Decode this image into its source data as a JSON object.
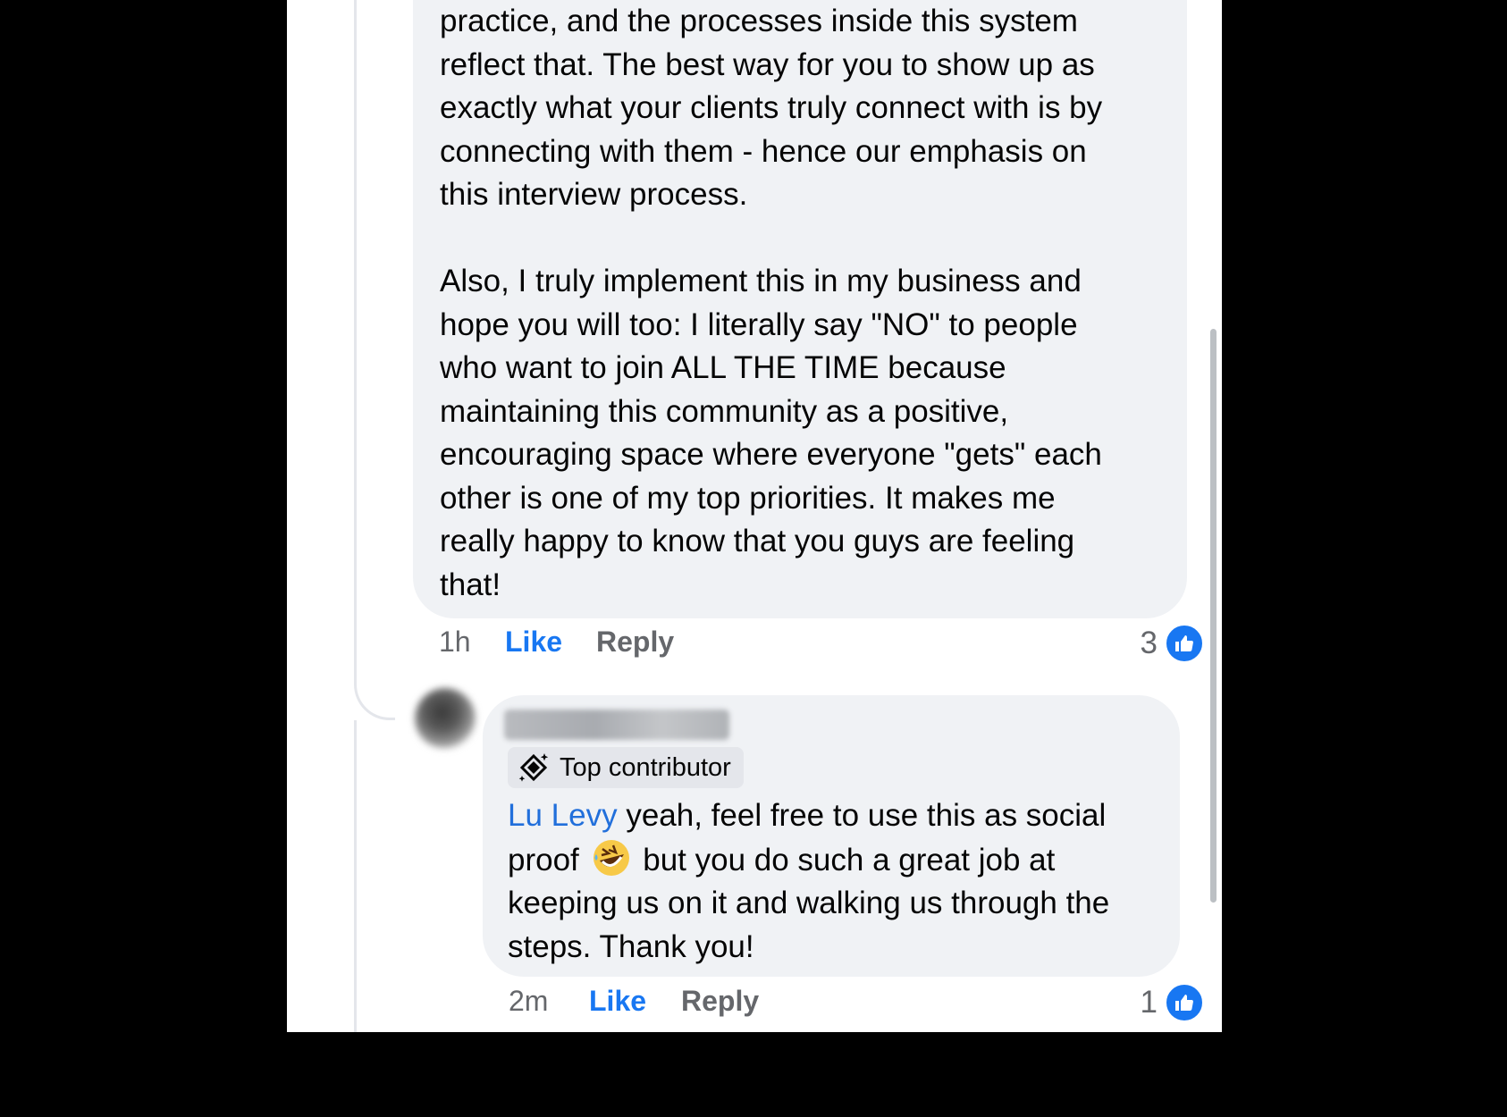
{
  "comment1": {
    "paragraph1_lines": [
      "practice, and the processes inside this system",
      "reflect that. The best way for you to show up as",
      "exactly what your clients truly connect with is by",
      "connecting with them - hence our emphasis on",
      "this interview process."
    ],
    "paragraph2_lines": [
      "Also, I truly implement this in my business and",
      "hope you will too: I literally say \"NO\" to people",
      "who want to join ALL THE TIME because",
      "maintaining this community as a positive,",
      "encouraging space where everyone \"gets\" each",
      "other is one of my top priorities. It makes me",
      "really happy to know that you guys are feeling",
      "that!"
    ],
    "time": "1h",
    "like_label": "Like",
    "reply_label": "Reply",
    "reaction_count": "3"
  },
  "comment2": {
    "badge_label": "Top contributor",
    "mention": "Lu Levy",
    "text_part1": " yeah, feel free to use this as social proof ",
    "emoji": "rolling-on-the-floor-laughing",
    "text_part2": " but you do such a great job at keeping us on it and walking us through the steps. Thank you!",
    "time": "2m",
    "like_label": "Like",
    "reply_label": "Reply",
    "reaction_count": "1"
  },
  "colors": {
    "bubble": "#f0f2f5",
    "like_blue": "#1877f2",
    "mention_blue": "#216fdb",
    "meta_gray": "#65676b"
  }
}
